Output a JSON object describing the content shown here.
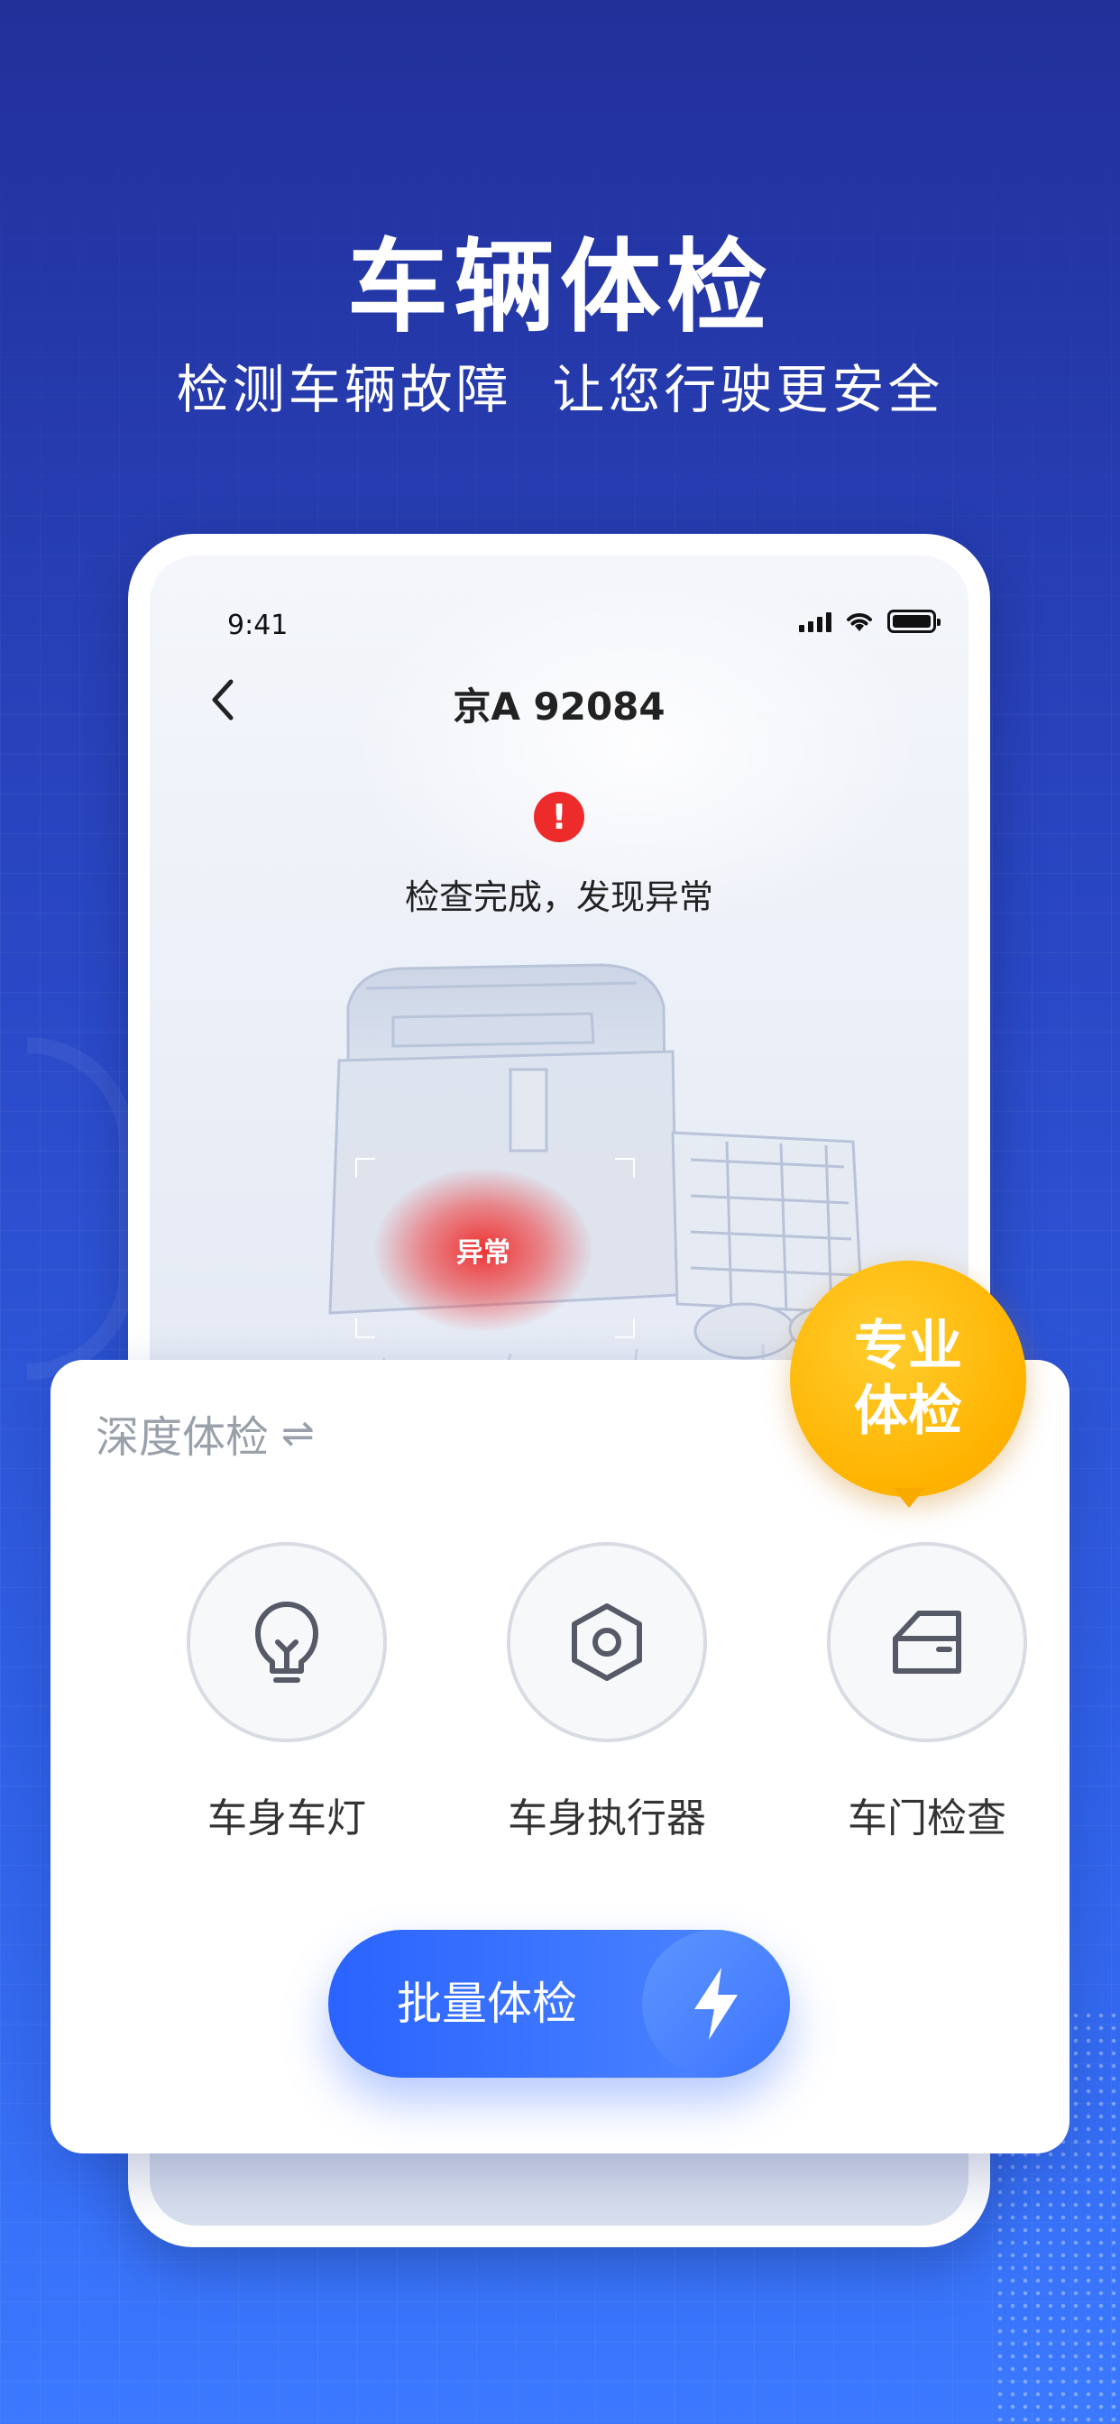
{
  "promo": {
    "headline": "车辆体检",
    "subline": "检测车辆故障  让您行驶更安全"
  },
  "status_bar": {
    "time": "9:41"
  },
  "screen": {
    "plate": "京A 92084",
    "alert_text": "检查完成，发现异常",
    "alert_glyph": "!",
    "anomaly_label": "异常"
  },
  "card": {
    "title": "深度体检",
    "swap_glyph": "⇌",
    "items": [
      {
        "label": "车身车灯",
        "icon": "bulb-icon"
      },
      {
        "label": "车身执行器",
        "icon": "hexagon-nut-icon"
      },
      {
        "label": "车门检查",
        "icon": "car-door-icon"
      }
    ],
    "batch_button": "批量体检"
  },
  "badge": {
    "line1": "专业",
    "line2": "体检"
  },
  "colors": {
    "accent_blue": "#2a63ff",
    "alert_red": "#ee2b2b",
    "badge_yellow": "#ffb300"
  }
}
